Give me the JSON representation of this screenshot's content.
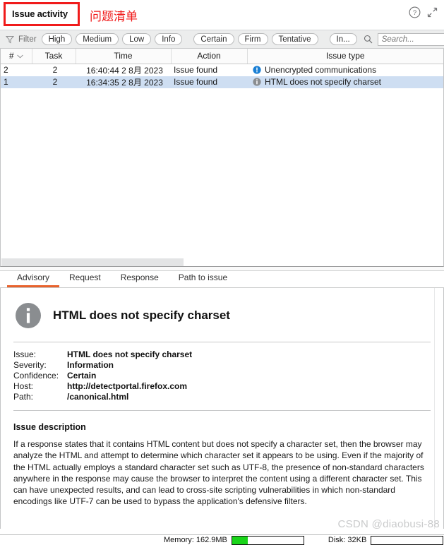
{
  "titlebar": {
    "title": "Issue activity",
    "annotation_cn": "问题清单",
    "help_icon": "help-circle-icon",
    "expand_icon": "expand-diagonal-icon",
    "annotation_color": "#f01b1b"
  },
  "filterbar": {
    "funnel_icon": "funnel-icon",
    "filter_label": "Filter",
    "severity_pills": [
      "High",
      "Medium",
      "Low",
      "Info"
    ],
    "confidence_pills": [
      "Certain",
      "Firm",
      "Tentative"
    ],
    "extra_pills": [
      "In..."
    ],
    "search_icon": "search-icon",
    "search_value": "",
    "search_placeholder": "Search..."
  },
  "table": {
    "columns": [
      "#",
      "Task",
      "Time",
      "Action",
      "Issue type"
    ],
    "sort_indicator": "chevron-down-icon",
    "rows": [
      {
        "num": "2",
        "task": "2",
        "time": "16:40:44 2 8月 2023",
        "action": "Issue found",
        "issue_type": "Unencrypted communications",
        "severity_icon": "info-exclamation-icon",
        "severity_color": "#1a7fd4",
        "selected": false
      },
      {
        "num": "1",
        "task": "2",
        "time": "16:34:35 2 8月 2023",
        "action": "Issue found",
        "issue_type": "HTML does not specify charset",
        "severity_icon": "info-circle-icon",
        "severity_color": "#8a8d90",
        "selected": true
      }
    ]
  },
  "tabs": {
    "items": [
      "Advisory",
      "Request",
      "Response",
      "Path to issue"
    ],
    "active": "Advisory",
    "active_underline_color": "#e8622c"
  },
  "advisory": {
    "icon": "info-circle-icon",
    "icon_color": "#8a8d90",
    "heading": "HTML does not specify charset",
    "fields": [
      {
        "key": "Issue:",
        "value": "HTML does not specify charset"
      },
      {
        "key": "Severity:",
        "value": "Information"
      },
      {
        "key": "Confidence:",
        "value": "Certain"
      },
      {
        "key": "Host:",
        "value": "http://detectportal.firefox.com"
      },
      {
        "key": "Path:",
        "value": "/canonical.html"
      }
    ],
    "description_title": "Issue description",
    "description_body": "If a response states that it contains HTML content but does not specify a character set, then the browser may analyze the HTML and attempt to determine which character set it appears to be using. Even if the majority of the HTML actually employs a standard character set such as UTF-8, the presence of non-standard characters anywhere in the response may cause the browser to interpret the content using a different character set. This can have unexpected results, and can lead to cross-site scripting vulnerabilities in which non-standard encodings like UTF-7 can be used to bypass the application's defensive filters."
  },
  "watermark": {
    "text": "CSDN @diaobusi-88"
  },
  "statusbar": {
    "memory_label": "Memory: 162.9MB",
    "memory_fill_color": "#19d419",
    "disk_label": "Disk: 32KB"
  }
}
